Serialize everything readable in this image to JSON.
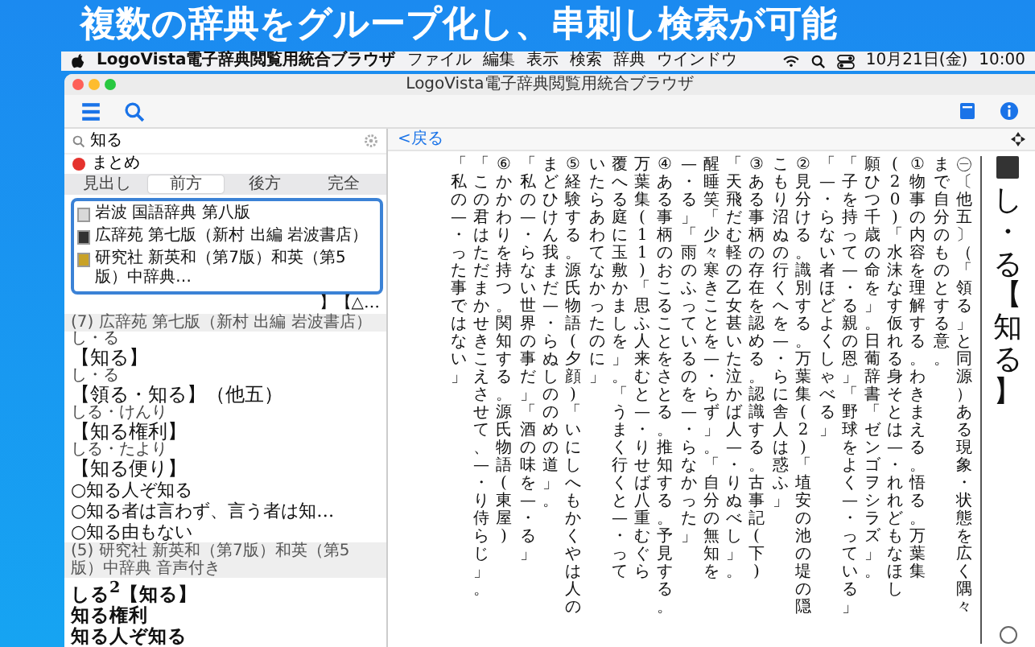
{
  "headline": "複数の辞典をグループ化し、串刺し検索が可能",
  "menubar": {
    "app": "LogoVista電子辞典閲覧用統合ブラウザ",
    "menus": [
      "ファイル",
      "編集",
      "表示",
      "検索",
      "辞典",
      "ウインドウ"
    ],
    "date": "10月21日(金)",
    "time": "10:00"
  },
  "window": {
    "title": "LogoVista電子辞典閲覧用統合ブラウザ"
  },
  "search": {
    "value": "知る"
  },
  "group": {
    "label": "まとめ",
    "color": "#e5322d"
  },
  "tabs": [
    {
      "label": "見出し",
      "selected": false
    },
    {
      "label": "前方",
      "selected": true
    },
    {
      "label": "後方",
      "selected": false
    },
    {
      "label": "完全",
      "selected": false
    }
  ],
  "dictionary_menu": [
    {
      "name": "岩波 国語辞典 第八版",
      "color": "#d9d9d9"
    },
    {
      "name": "広辞苑 第七版（新村 出編 岩波書店）",
      "color": "#333333"
    },
    {
      "name": "研究社 新英和（第7版）和英（第5版）中辞典…",
      "color": "#c9a227"
    }
  ],
  "results_peek": "】【△…",
  "results": [
    {
      "kind": "section",
      "text": "(7) 広辞苑 第七版（新村 出編 岩波書店）"
    },
    {
      "kind": "entry",
      "reading": "し・る",
      "headword": "【知る】"
    },
    {
      "kind": "entry",
      "reading": "し・る",
      "headword": "【領る・知る】（他五）"
    },
    {
      "kind": "entry",
      "reading": "しる・けんり",
      "headword": "【知る権利】"
    },
    {
      "kind": "entry",
      "reading": "しる・たより",
      "headword": "【知る便り】"
    },
    {
      "kind": "phrase",
      "text": "○知る人ぞ知る"
    },
    {
      "kind": "phrase",
      "text": "○知る者は言わず、言う者は知…"
    },
    {
      "kind": "phrase",
      "text": "○知る由もない"
    },
    {
      "kind": "section",
      "text": "(5) 研究社 新英和（第7版）和英（第5版）中辞典 音声付き"
    },
    {
      "kind": "word",
      "text": "しる$^{2}$【知る】"
    },
    {
      "kind": "word",
      "text": "知る権利"
    },
    {
      "kind": "word",
      "text": "知る人ぞ知る"
    }
  ],
  "reader": {
    "back": "<戻る",
    "headword": "し・る【知る】",
    "paragraphs": [
      {
        "columns": [
          "「私の—・った事ではない」",
          "「この君はただまかせきこえさせて、—・り侍らじ」。",
          "⑥かかわりを持つ。関知する。源氏物語(東屋)"
        ]
      },
      {
        "columns": [
          "「私の—・らない世界の事だ」「酒の味を—・る」",
          "まどひけん我まだ—・らぬしののめの道」。",
          "⑤経験する。源氏物語(夕顔)「いにしへもかくやは人の"
        ]
      },
      {
        "columns": [
          "いたらあわてなかったのに」",
          "覆へる庭に玉敷かましを」。「うまく行くと—・って",
          "万葉集(11)「思ふ人来むと—・りせば八重むぐら",
          "④ある事柄のおこることをさとる。推知する。予見する。"
        ]
      },
      {
        "columns": [
          "—・る」「雨のふっているのを—・らなかった」",
          "醒睡笑「少々寒きことを—・らず」。「自分の無知を",
          "「天飛だむ軽の乙女甚いた泣かば人—・りぬべし」。",
          "③ある事柄の存在を認める。認識する。古事記(下)"
        ]
      },
      {
        "columns": [
          "こもり沼ぬの行くへを—・らに舎人は惑ふ」",
          "②見分ける。識別する。万葉集(2)「埴安の池の堤の隠"
        ]
      },
      {
        "columns": [
          "「—・らない者ほどよくしゃべる」",
          "「子を持って—・る親の恩」「野球をよく—・っている」",
          "願ひつ千歳の命を」。日葡辞書「ゼンゴヲシラズ」。",
          "(20)「水沫なす仮れる身そとは—・れれどもなほし",
          "①物事の内容を理解する。わきまえる。悟る。万葉集"
        ]
      },
      {
        "columns": [
          "まで自分のものとする意。",
          "㊀〔他五〕（「領る」と同源）ある現象・状態を広く隅々"
        ]
      }
    ]
  }
}
